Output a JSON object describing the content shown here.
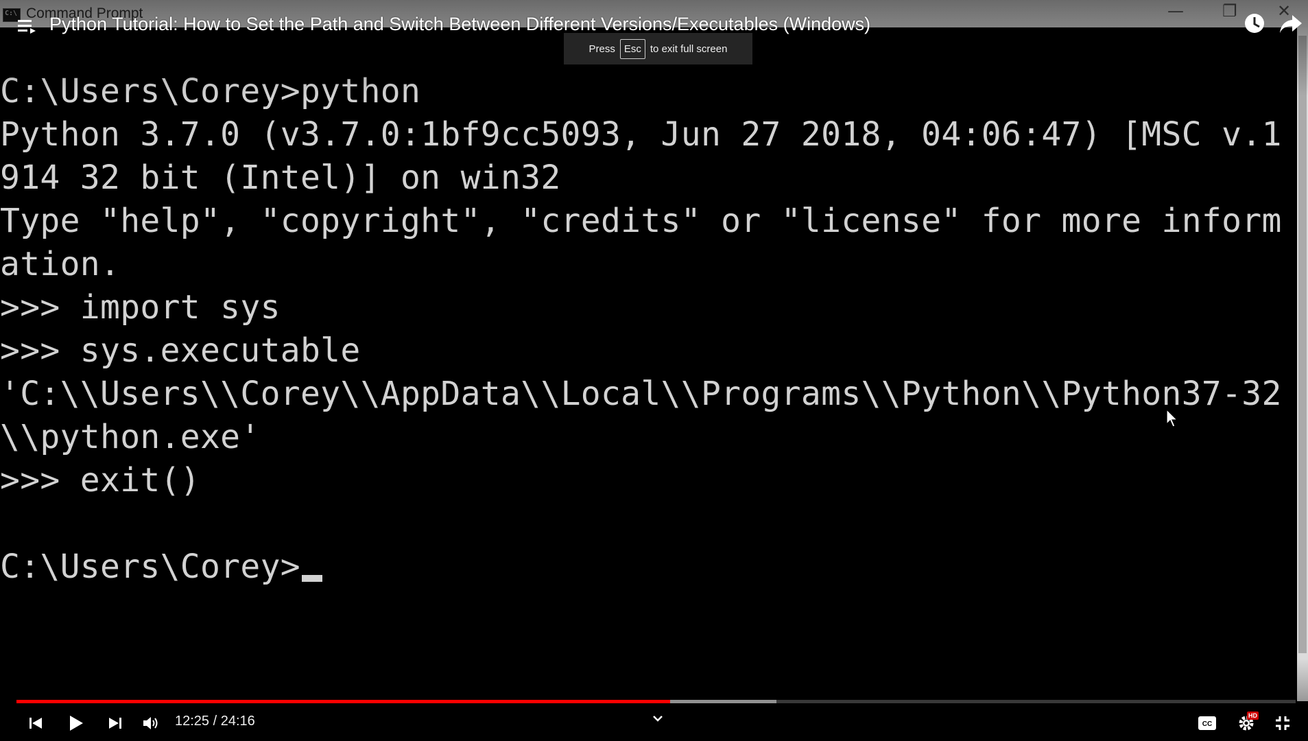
{
  "window": {
    "app_title": "Command Prompt",
    "controls": [
      "minimize-icon",
      "restore-icon",
      "close-icon"
    ]
  },
  "player": {
    "video_title": "Python Tutorial: How to Set the Path and Switch Between Different Versions/Executables (Windows)",
    "toast": {
      "prefix": "Press",
      "key": "Esc",
      "suffix": "to exit full screen"
    },
    "time": "12:25 / 24:16",
    "progress_played_fraction": 0.511,
    "progress_buffered_fraction": 0.594,
    "accent_color": "#ff0000",
    "quality_badge": "HD",
    "top_right_icons": [
      "watch-later-icon",
      "share-icon"
    ],
    "controls": [
      "previous-icon",
      "play-icon",
      "next-icon",
      "volume-icon",
      "chevron-down-icon",
      "captions-icon",
      "settings-icon",
      "exit-fullscreen-icon"
    ]
  },
  "console": {
    "lines": [
      "C:\\Users\\Corey>python",
      "Python 3.7.0 (v3.7.0:1bf9cc5093, Jun 27 2018, 04:06:47) [MSC v.1",
      "914 32 bit (Intel)] on win32",
      "Type \"help\", \"copyright\", \"credits\" or \"license\" for more inform",
      "ation.",
      ">>> import sys",
      ">>> sys.executable",
      "'C:\\\\Users\\\\Corey\\\\AppData\\\\Local\\\\Programs\\\\Python\\\\Python37-32",
      "\\\\python.exe'",
      ">>> exit()",
      "",
      "C:\\Users\\Corey>"
    ],
    "text_color": "#d2d2d2",
    "background_color": "#000000"
  }
}
